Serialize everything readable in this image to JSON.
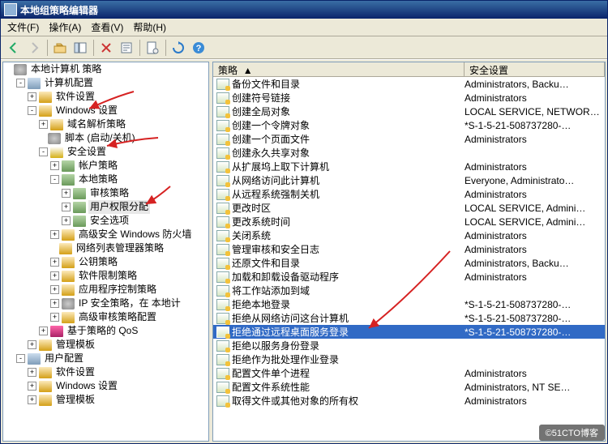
{
  "window": {
    "title": "本地组策略编辑器"
  },
  "menu": {
    "file": "文件(F)",
    "action": "操作(A)",
    "view": "查看(V)",
    "help": "帮助(H)"
  },
  "tree": {
    "root": "本地计算机 策略",
    "cc": "计算机配置",
    "sw": "软件设置",
    "ws": "Windows 设置",
    "dns": "域名解析策略",
    "script": "脚本 (启动/关机)",
    "sec": "安全设置",
    "acct": "帐户策略",
    "local": "本地策略",
    "audit": "审核策略",
    "ura": "用户权限分配",
    "secopt": "安全选项",
    "wfas": "高级安全 Windows 防火墙",
    "nlm": "网络列表管理器策略",
    "pk": "公钥策略",
    "srp": "软件限制策略",
    "acp": "应用程序控制策略",
    "ipsec": "IP 安全策略，在 本地计",
    "aac": "高级审核策略配置",
    "qos": "基于策略的 QoS",
    "admt": "管理模板",
    "uc": "用户配置",
    "sw2": "软件设置",
    "ws2": "Windows 设置",
    "admt2": "管理模板"
  },
  "columns": {
    "policy": "策略",
    "security": "安全设置",
    "sortmark": "▲"
  },
  "policies": [
    {
      "name": "备份文件和目录",
      "val": "Administrators, Backu…"
    },
    {
      "name": "创建符号链接",
      "val": "Administrators"
    },
    {
      "name": "创建全局对象",
      "val": "LOCAL SERVICE, NETWOR…"
    },
    {
      "name": "创建一个令牌对象",
      "val": "*S-1-5-21-508737280-…"
    },
    {
      "name": "创建一个页面文件",
      "val": "Administrators"
    },
    {
      "name": "创建永久共享对象",
      "val": ""
    },
    {
      "name": "从扩展坞上取下计算机",
      "val": "Administrators"
    },
    {
      "name": "从网络访问此计算机",
      "val": "Everyone, Administrato…"
    },
    {
      "name": "从远程系统强制关机",
      "val": "Administrators"
    },
    {
      "name": "更改时区",
      "val": "LOCAL SERVICE, Admini…"
    },
    {
      "name": "更改系统时间",
      "val": "LOCAL SERVICE, Admini…"
    },
    {
      "name": "关闭系统",
      "val": "Administrators"
    },
    {
      "name": "管理审核和安全日志",
      "val": "Administrators"
    },
    {
      "name": "还原文件和目录",
      "val": "Administrators, Backu…"
    },
    {
      "name": "加载和卸载设备驱动程序",
      "val": "Administrators"
    },
    {
      "name": "将工作站添加到域",
      "val": ""
    },
    {
      "name": "拒绝本地登录",
      "val": "*S-1-5-21-508737280-…"
    },
    {
      "name": "拒绝从网络访问这台计算机",
      "val": "*S-1-5-21-508737280-…"
    },
    {
      "name": "拒绝通过远程桌面服务登录",
      "val": "*S-1-5-21-508737280-…",
      "selected": true
    },
    {
      "name": "拒绝以服务身份登录",
      "val": ""
    },
    {
      "name": "拒绝作为批处理作业登录",
      "val": ""
    },
    {
      "name": "配置文件单个进程",
      "val": "Administrators"
    },
    {
      "name": "配置文件系统性能",
      "val": "Administrators, NT SE…"
    },
    {
      "name": "取得文件或其他对象的所有权",
      "val": "Administrators"
    }
  ],
  "watermark": "©51CTO博客"
}
